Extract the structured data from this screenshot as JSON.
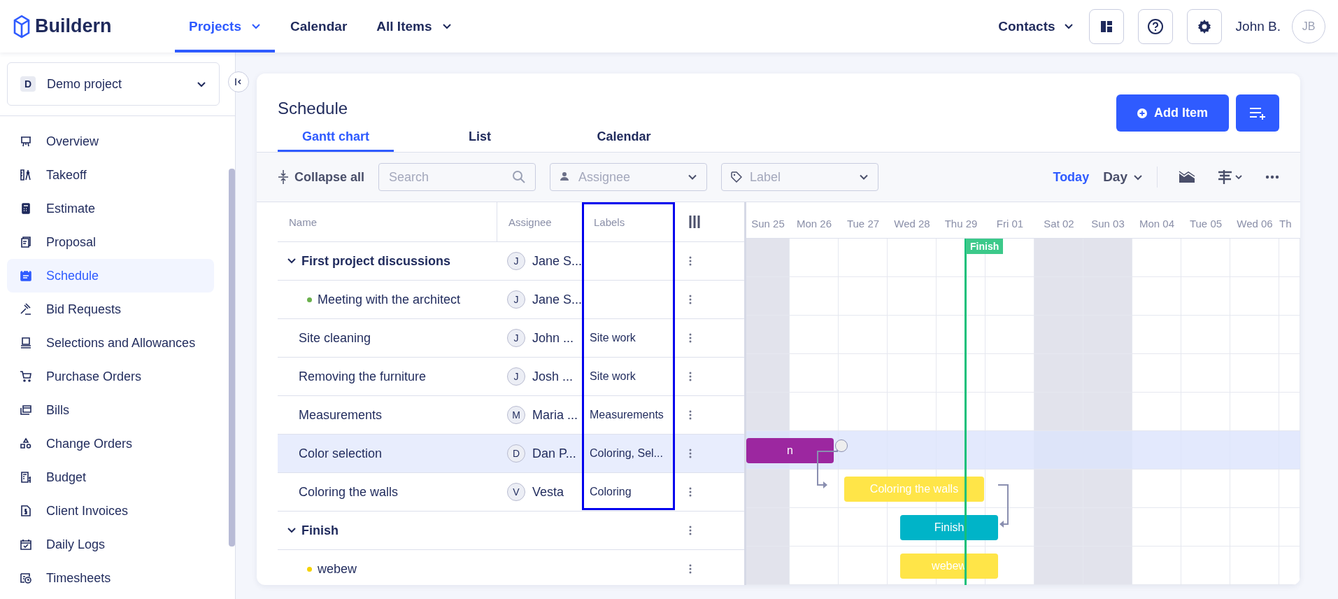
{
  "brand": {
    "name": "Buildern"
  },
  "nav": [
    {
      "label": "Projects",
      "selected": true,
      "dropdown": true
    },
    {
      "label": "Calendar",
      "selected": false,
      "dropdown": false
    },
    {
      "label": "All Items",
      "selected": false,
      "dropdown": true
    }
  ],
  "header_right": {
    "contacts": "Contacts",
    "user_name": "John B.",
    "user_initials": "JB"
  },
  "project": {
    "initial": "D",
    "name": "Demo project"
  },
  "sidebar": {
    "items": [
      {
        "label": "Overview",
        "selected": false
      },
      {
        "label": "Takeoff",
        "selected": false
      },
      {
        "label": "Estimate",
        "selected": false
      },
      {
        "label": "Proposal",
        "selected": false
      },
      {
        "label": "Schedule",
        "selected": true
      },
      {
        "label": "Bid Requests",
        "selected": false
      },
      {
        "label": "Selections and Allowances",
        "selected": false
      },
      {
        "label": "Purchase Orders",
        "selected": false
      },
      {
        "label": "Bills",
        "selected": false
      },
      {
        "label": "Change Orders",
        "selected": false
      },
      {
        "label": "Budget",
        "selected": false
      },
      {
        "label": "Client Invoices",
        "selected": false
      },
      {
        "label": "Daily Logs",
        "selected": false
      },
      {
        "label": "Timesheets",
        "selected": false
      }
    ]
  },
  "page": {
    "title": "Schedule",
    "add_button": "Add Item"
  },
  "tabs": [
    {
      "label": "Gantt chart",
      "selected": true
    },
    {
      "label": "List",
      "selected": false
    },
    {
      "label": "Calendar",
      "selected": false
    }
  ],
  "toolbar": {
    "collapse": "Collapse all",
    "search_placeholder": "Search",
    "assignee_placeholder": "Assignee",
    "label_placeholder": "Label",
    "today": "Today",
    "scale": "Day"
  },
  "table": {
    "columns": [
      "Name",
      "Assignee",
      "Labels"
    ],
    "rows": [
      {
        "kind": "group",
        "name": "First project discussions",
        "expanded": true,
        "initial": "J",
        "assignee": "Jane S...",
        "label": "",
        "selected": false
      },
      {
        "kind": "sub",
        "name": "Meeting with the architect",
        "color": "#6ab04c",
        "initial": "J",
        "assignee": "Jane S...",
        "label": "",
        "selected": false
      },
      {
        "kind": "task",
        "name": "Site cleaning",
        "initial": "J",
        "assignee": "John ...",
        "label": "Site work",
        "selected": false
      },
      {
        "kind": "task",
        "name": "Removing the furniture",
        "initial": "J",
        "assignee": "Josh ...",
        "label": "Site work",
        "selected": false
      },
      {
        "kind": "task",
        "name": "Measurements",
        "initial": "M",
        "assignee": "Maria ...",
        "label": "Measurements",
        "selected": false
      },
      {
        "kind": "task",
        "name": "Color selection",
        "initial": "D",
        "assignee": "Dan P...",
        "label": "Coloring, Sel...",
        "selected": true
      },
      {
        "kind": "task",
        "name": "Coloring the walls",
        "initial": "V",
        "assignee": "Vesta",
        "label": "Coloring",
        "selected": false
      },
      {
        "kind": "group",
        "name": "Finish",
        "expanded": true,
        "initial": "",
        "assignee": "",
        "label": "",
        "selected": false
      },
      {
        "kind": "sub",
        "name": "webew",
        "color": "#f5d200",
        "initial": "",
        "assignee": "",
        "label": "",
        "selected": false
      }
    ]
  },
  "timeline": {
    "days": [
      {
        "label": "Sun 25",
        "weekend": true
      },
      {
        "label": "Mon 26",
        "weekend": false
      },
      {
        "label": "Tue 27",
        "weekend": false
      },
      {
        "label": "Wed 28",
        "weekend": false
      },
      {
        "label": "Thu 29",
        "weekend": false
      },
      {
        "label": "Fri 01",
        "weekend": false
      },
      {
        "label": "Sat 02",
        "weekend": true
      },
      {
        "label": "Sun 03",
        "weekend": true
      },
      {
        "label": "Mon 04",
        "weekend": false
      },
      {
        "label": "Tue 05",
        "weekend": false
      },
      {
        "label": "Wed 06",
        "weekend": false
      },
      {
        "label": "Th",
        "weekend": false
      }
    ],
    "marker": "Finish",
    "bars": [
      {
        "label": "n",
        "color": "#9c27a0"
      },
      {
        "label": "Coloring the walls",
        "color": "#ffe548"
      },
      {
        "label": "Finish",
        "color": "#00b4c8"
      },
      {
        "label": "webew",
        "color": "#ffe548"
      }
    ]
  }
}
